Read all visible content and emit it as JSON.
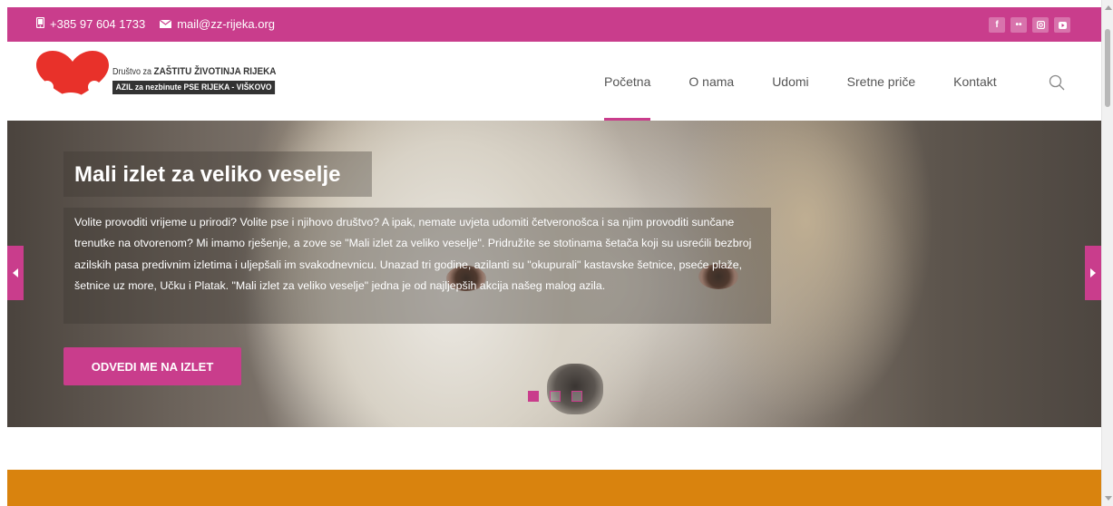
{
  "topbar": {
    "phone": "+385 97 604 1733",
    "email": "mail@zz-rijeka.org",
    "social_icons": [
      "facebook-icon",
      "flickr-icon",
      "instagram-icon",
      "youtube-icon"
    ]
  },
  "logo": {
    "line1_prefix": "Društvo za",
    "line1_bold": "ZAŠTITU ŽIVOTINJA RIJEKA",
    "line2": "AZIL za nezbinute PSE RIJEKA - VIŠKOVO"
  },
  "nav": {
    "items": [
      "Početna",
      "O nama",
      "Udomi",
      "Sretne priče",
      "Kontakt"
    ],
    "active_index": 0
  },
  "hero": {
    "title": "Mali izlet za veliko veselje",
    "text": "Volite provoditi vrijeme u prirodi? Volite pse i njihovo društvo? A ipak, nemate uvjeta udomiti četveronošca i sa njim provoditi sunčane trenutke na otvorenom? Mi imamo rješenje, a zove se \"Mali izlet za veliko veselje\". Pridružite se stotinama šetača koji su usrećili bezbroj azilskih pasa predivnim izletima i uljepšali im svakodnevnicu. Unazad tri godine, azilanti su \"okupurali\" kastavske šetnice, pseće plaže, šetnice uz more, Učku i Platak. \"Mali izlet za veliko veselje\" jedna je od najljepših akcija našeg malog azila.",
    "cta": "ODVEDI ME NA IZLET",
    "slides": 3,
    "active_slide": 0
  },
  "colors": {
    "accent": "#c93d8c",
    "band": "#d9830e"
  }
}
